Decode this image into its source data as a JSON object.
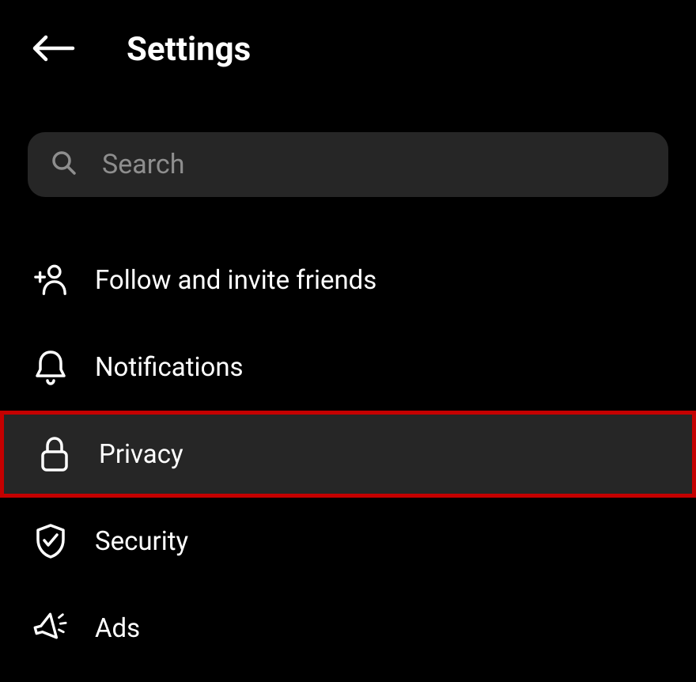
{
  "header": {
    "title": "Settings"
  },
  "search": {
    "placeholder": "Search"
  },
  "items": [
    {
      "label": "Follow and invite friends",
      "icon": "add-user-icon",
      "highlighted": false
    },
    {
      "label": "Notifications",
      "icon": "bell-icon",
      "highlighted": false
    },
    {
      "label": "Privacy",
      "icon": "lock-icon",
      "highlighted": true
    },
    {
      "label": "Security",
      "icon": "shield-check-icon",
      "highlighted": false
    },
    {
      "label": "Ads",
      "icon": "megaphone-icon",
      "highlighted": false
    }
  ]
}
